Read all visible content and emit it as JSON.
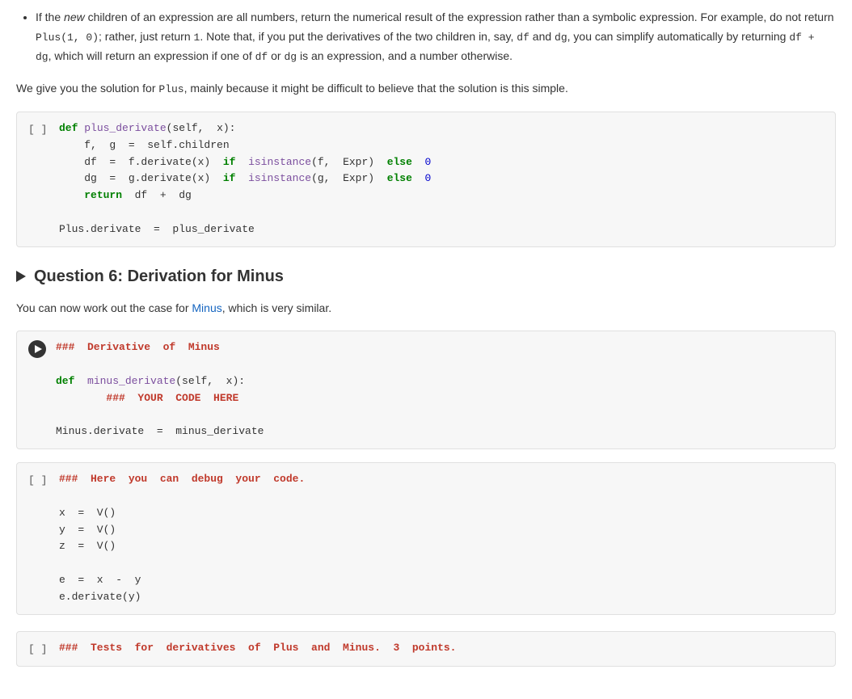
{
  "bullet_items": [
    {
      "id": 1,
      "text_parts": [
        {
          "text": "If the ",
          "type": "normal"
        },
        {
          "text": "new",
          "type": "italic"
        },
        {
          "text": " children of an expression are all numbers, return the numerical result of the expression rather than a symbolic expression. For example, do not return ",
          "type": "normal"
        },
        {
          "text": "Plus(1, 0)",
          "type": "code"
        },
        {
          "text": "; rather, just return ",
          "type": "normal"
        },
        {
          "text": "1",
          "type": "code"
        },
        {
          "text": ". Note that, if you put the derivatives of the two children in, say, ",
          "type": "normal"
        },
        {
          "text": "df",
          "type": "code"
        },
        {
          "text": " and ",
          "type": "normal"
        },
        {
          "text": "dg",
          "type": "code"
        },
        {
          "text": ", you can simplify automatically by returning ",
          "type": "normal"
        },
        {
          "text": "df + dg",
          "type": "code"
        },
        {
          "text": ", which will return an expression if one of ",
          "type": "normal"
        },
        {
          "text": "df",
          "type": "code"
        },
        {
          "text": " or ",
          "type": "normal"
        },
        {
          "text": "dg",
          "type": "code"
        },
        {
          "text": " is an expression, and a number otherwise.",
          "type": "normal"
        }
      ]
    }
  ],
  "intro_text": "We give you the solution for",
  "intro_code": "Plus",
  "intro_text2": ", mainly because it might be difficult to believe that the solution is this simple.",
  "code_cell_1": {
    "bracket": "[ ]",
    "code": "def plus_derivate(self,  x):\n    f,  g  =  self.children\n    df  =  f.derivate(x)  if  isinstance(f,  Expr)  else  0\n    dg  =  g.derivate(x)  if  isinstance(g,  Expr)  else  0\n    return  df  +  dg\n\nPlus.derivate  =  plus_derivate"
  },
  "question_6": {
    "number": "Question 6:",
    "title": "Derivation for Minus"
  },
  "description": "You can now work out the case for",
  "description_code": "Minus",
  "description_text2": ", which is very similar.",
  "run_cell": {
    "comment": "###  Derivative  of  Minus",
    "code": "\ndef  minus_derivate(self,  x):\n        ###  YOUR  CODE  HERE\n\nMinus.derivate  =  minus_derivate"
  },
  "debug_cell": {
    "bracket": "[ ]",
    "comment": "###  Here  you  can  debug  your  code.",
    "code": "\nx  =  V()\ny  =  V()\nz  =  V()\n\ne  =  x  -  y\ne.derivate(y)"
  },
  "tests_cell": {
    "bracket": "[ ]",
    "comment": "###  Tests  for  derivatives  of  Plus  and  Minus.  3  points."
  }
}
